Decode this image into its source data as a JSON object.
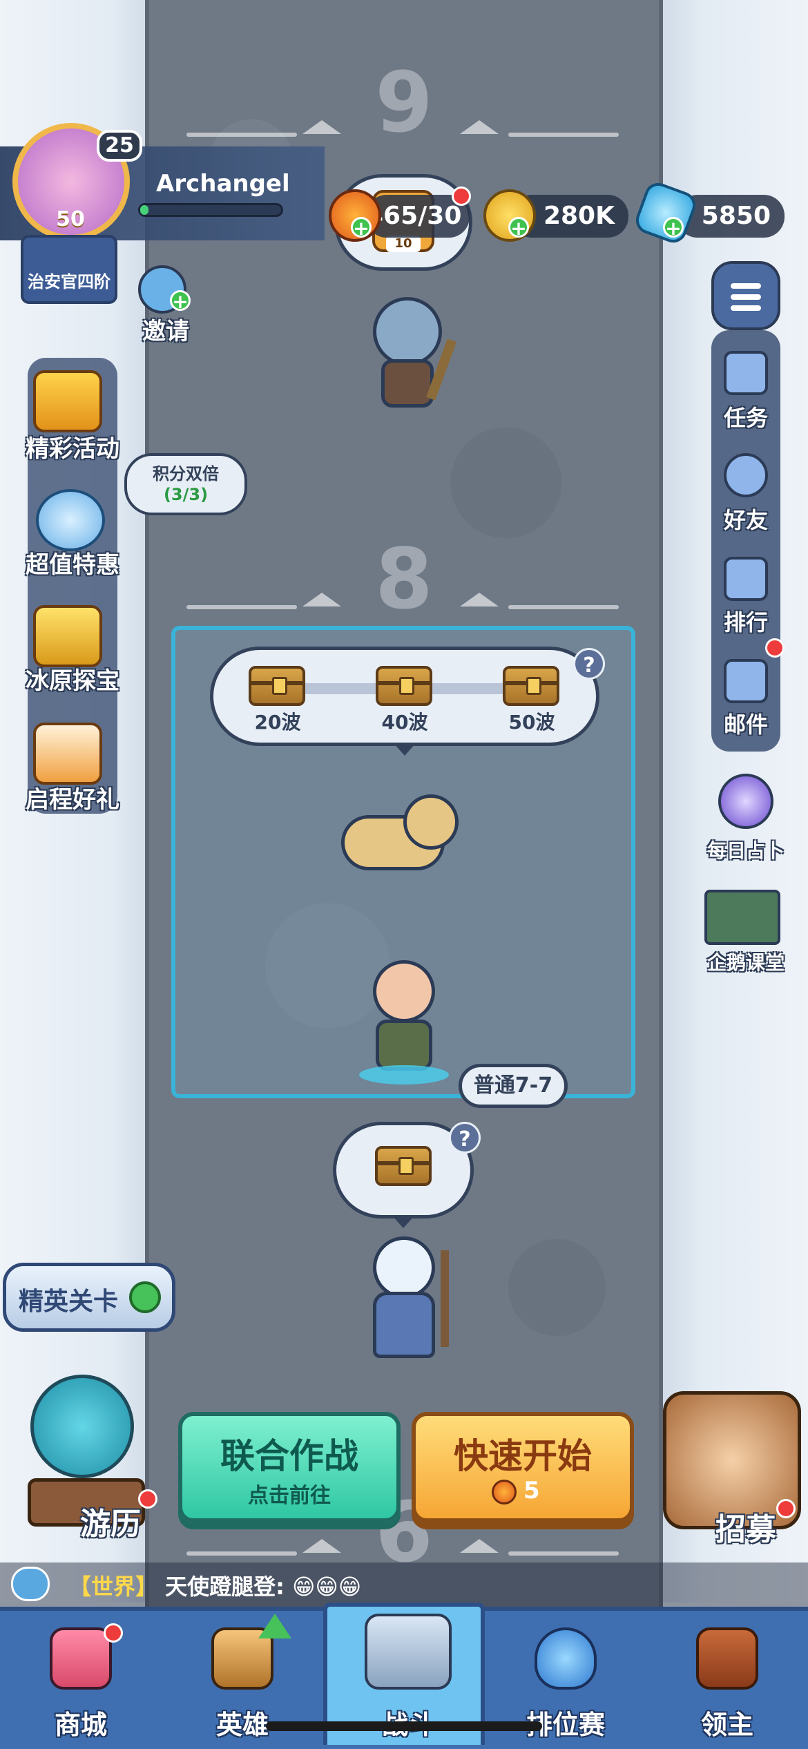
{
  "player": {
    "name": "Archangel",
    "level": "25",
    "rank_level": "50",
    "rank_title": "治安官四阶",
    "xp_fraction": 0.06
  },
  "currency": {
    "stamina": "465/30",
    "gold": "280K",
    "gems": "5850",
    "stamina_timer": "10"
  },
  "top_actions": {
    "invite_label": "邀请"
  },
  "left_menu": [
    {
      "label": "精彩活动",
      "icon": "treasure-chest-icon"
    },
    {
      "label": "超值特惠",
      "icon": "stopwatch-icon"
    },
    {
      "label": "冰原探宝",
      "icon": "crown-icon"
    },
    {
      "label": "启程好礼",
      "icon": "winged-fox-icon"
    }
  ],
  "double_points": {
    "title": "积分双倍",
    "count": "(3/3)"
  },
  "right_menu": [
    {
      "label": "任务",
      "icon": "task-list-icon"
    },
    {
      "label": "好友",
      "icon": "friends-icon"
    },
    {
      "label": "排行",
      "icon": "podium-icon"
    },
    {
      "label": "邮件",
      "icon": "mail-icon"
    }
  ],
  "right_extra": [
    {
      "label": "每日占卜",
      "icon": "crystal-ball-icon"
    },
    {
      "label": "企鹅课堂",
      "icon": "penguin-classroom-icon"
    }
  ],
  "waves": {
    "top": "9",
    "mid": "8",
    "bottom": "6"
  },
  "rewards": [
    {
      "label": "20波"
    },
    {
      "label": "40波"
    },
    {
      "label": "50波"
    }
  ],
  "help_mark": "?",
  "stage_tag": "普通7-7",
  "elite_stage": "精英关卡",
  "adventure_label": "游历",
  "recruit_label": "招募",
  "buttons": {
    "coop_main": "联合作战",
    "coop_sub": "点击前往",
    "quick_main": "快速开始",
    "quick_cost": "5"
  },
  "chat": {
    "channel": "【世界】",
    "message": "天使蹬腿登: 😁😁😁"
  },
  "nav": [
    {
      "label": "商城",
      "icon": "shop-icon"
    },
    {
      "label": "英雄",
      "icon": "hero-card-icon"
    },
    {
      "label": "战斗",
      "icon": "battle-swords-icon"
    },
    {
      "label": "排位赛",
      "icon": "ranked-shield-icon"
    },
    {
      "label": "领主",
      "icon": "lord-banner-icon"
    }
  ],
  "colors": {
    "road": "#6f7986",
    "accent_green": "#2fc7a3",
    "accent_orange": "#f6a634",
    "nav_bg": "#3f6fb0",
    "nav_active": "#6fc3f0"
  }
}
